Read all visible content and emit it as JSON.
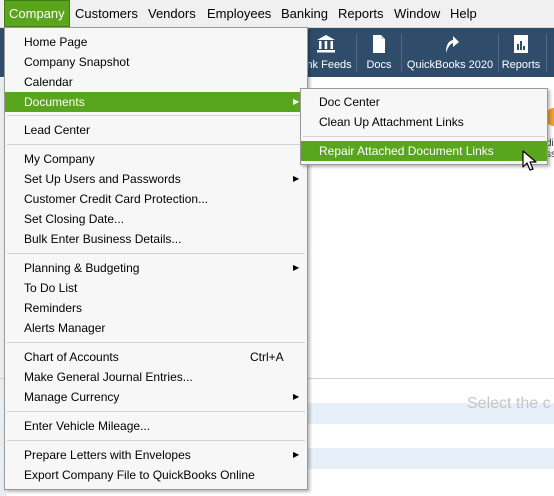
{
  "menubar": {
    "items": [
      "Company",
      "Customers",
      "Vendors",
      "Employees",
      "Banking",
      "Reports",
      "Window",
      "Help"
    ]
  },
  "toolbar": {
    "items": [
      {
        "label": "ank Feeds",
        "icon": "bank-icon"
      },
      {
        "label": "Docs",
        "icon": "docs-icon"
      },
      {
        "label": "QuickBooks 2020",
        "icon": "upgrade-arrow-icon"
      },
      {
        "label": "Reports",
        "icon": "reports-icon"
      }
    ]
  },
  "company_menu": {
    "home_page": "Home Page",
    "company_snapshot": "Company Snapshot",
    "calendar": "Calendar",
    "documents": "Documents",
    "lead_center": "Lead Center",
    "my_company": "My Company",
    "set_up_users": "Set Up Users and Passwords",
    "customer_cc_protection": "Customer Credit Card Protection...",
    "set_closing_date": "Set Closing Date...",
    "bulk_enter": "Bulk Enter Business Details...",
    "planning_budgeting": "Planning & Budgeting",
    "to_do_list": "To Do List",
    "reminders": "Reminders",
    "alerts_manager": "Alerts Manager",
    "chart_of_accounts": "Chart of Accounts",
    "chart_of_accounts_shortcut": "Ctrl+A",
    "general_journal": "Make General Journal Entries...",
    "manage_currency": "Manage Currency",
    "vehicle_mileage": "Enter Vehicle Mileage...",
    "prepare_letters": "Prepare Letters with Envelopes",
    "export_company_file": "Export Company File to QuickBooks Online"
  },
  "documents_submenu": {
    "doc_center": "Doc Center",
    "clean_up_links": "Clean Up Attachment Links",
    "repair_links": "Repair Attached Document Links"
  },
  "background": {
    "select_text": "Select the c",
    "right_text_1": "dit",
    "right_text_2": "ss"
  },
  "colors": {
    "highlight": "#5aa51e",
    "toolbar": "#2f4d6b",
    "menu_bg": "#f7f7f7"
  }
}
